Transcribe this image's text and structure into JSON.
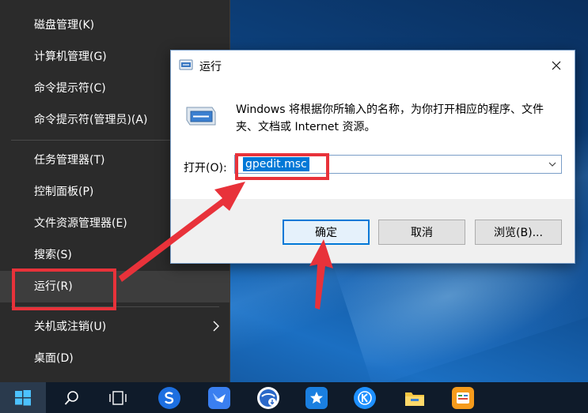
{
  "winx_menu": {
    "items": [
      {
        "label": "磁盘管理(K)"
      },
      {
        "label": "计算机管理(G)"
      },
      {
        "label": "命令提示符(C)"
      },
      {
        "label": "命令提示符(管理员)(A)"
      },
      {
        "label": "任务管理器(T)"
      },
      {
        "label": "控制面板(P)"
      },
      {
        "label": "文件资源管理器(E)"
      },
      {
        "label": "搜索(S)"
      },
      {
        "label": "运行(R)"
      },
      {
        "label": "关机或注销(U)"
      },
      {
        "label": "桌面(D)"
      }
    ]
  },
  "run_dialog": {
    "title": "运行",
    "description": "Windows 将根据你所输入的名称，为你打开相应的程序、文件夹、文档或 Internet 资源。",
    "open_label": "打开(O):",
    "input_value": "gpedit.msc",
    "ok_label": "确定",
    "cancel_label": "取消",
    "browse_label": "浏览(B)..."
  },
  "taskbar": {
    "items": [
      "start-icon",
      "search-icon",
      "task-view-icon",
      "sogou-browser-icon",
      "feishu-icon",
      "browser-download-icon",
      "favorites-star-icon",
      "kugou-icon",
      "file-explorer-icon",
      "ithome-icon"
    ]
  },
  "colors": {
    "annotation_red": "#e8323a",
    "selection_blue": "#0078d7",
    "menu_bg": "#2b2b2b"
  }
}
